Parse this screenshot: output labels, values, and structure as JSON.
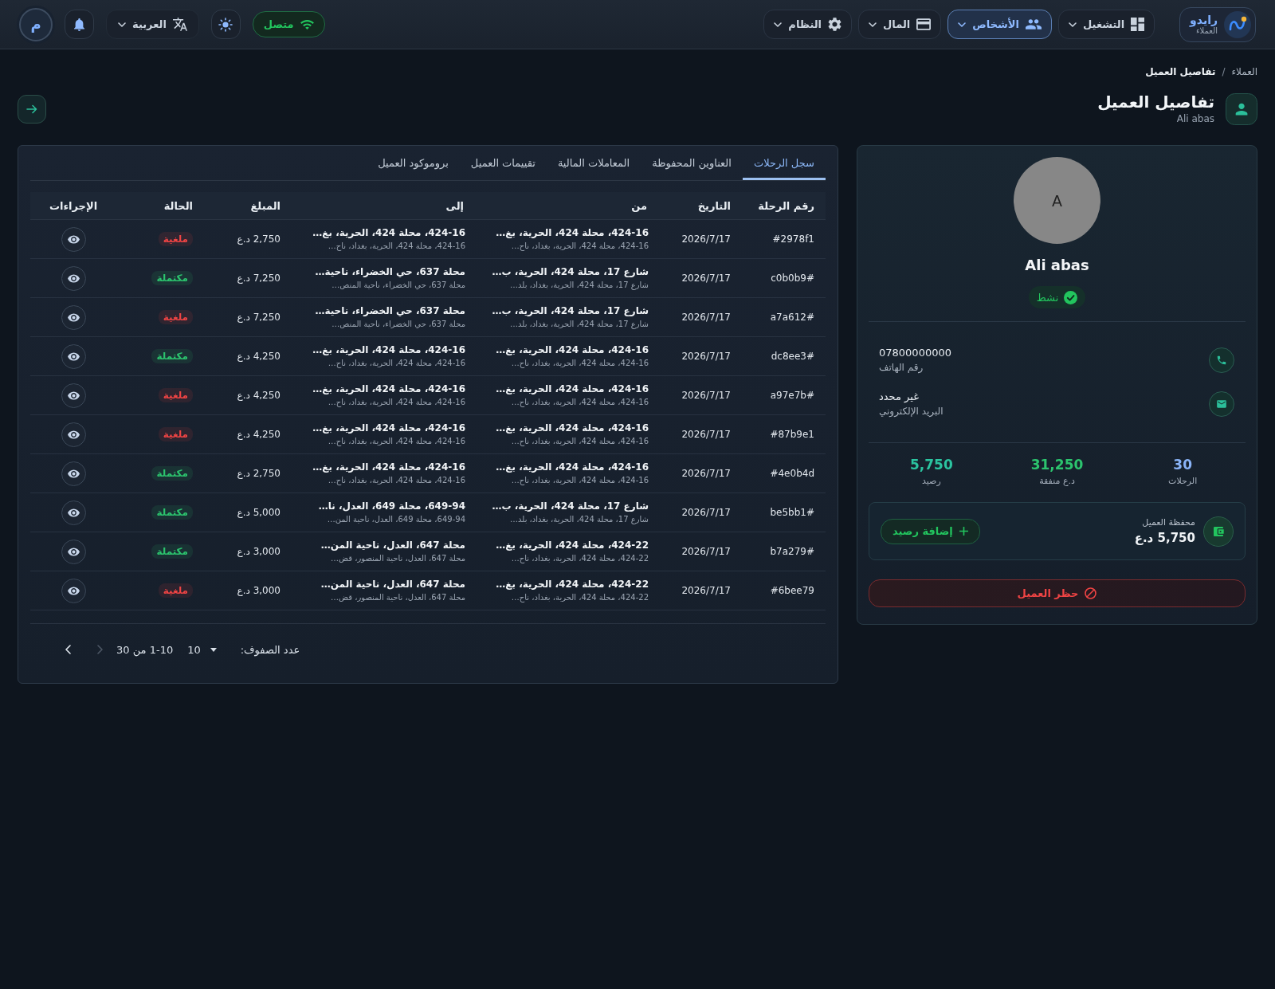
{
  "header": {
    "brand": {
      "name": "رايدو",
      "subtitle": "العملاء"
    },
    "nav": [
      {
        "label": "التشغيل",
        "selected": false
      },
      {
        "label": "الأشخاص",
        "selected": true
      },
      {
        "label": "المال",
        "selected": false
      },
      {
        "label": "النظام",
        "selected": false
      }
    ],
    "connection": {
      "label": "متصل",
      "connected": true
    },
    "language": {
      "label": "العربية"
    },
    "user": {
      "initial": "م"
    }
  },
  "breadcrumb": {
    "items": [
      "العملاء",
      "تفاصيل العميل"
    ],
    "separator": "/"
  },
  "page": {
    "title": "تفاصيل العميل",
    "subtitle": "Ali abas"
  },
  "customer": {
    "initial": "A",
    "name": "Ali abas",
    "status": {
      "label": "نشط",
      "active": true
    },
    "contacts": [
      {
        "kind": "phone",
        "value": "07800000000",
        "label": "رقم الهاتف"
      },
      {
        "kind": "email",
        "value": "غير محدد",
        "label": "البريد الإلكتروني"
      }
    ],
    "stats": [
      {
        "value": "30",
        "label": "الرحلات",
        "color": "#8ab4f8"
      },
      {
        "value": "31,250",
        "label": "د.ع منفقة",
        "color": "#2cc46e"
      },
      {
        "value": "5,750",
        "label": "رصيد",
        "color": "#2bc4a0"
      }
    ],
    "wallet": {
      "title": "محفظة العميل",
      "balance": "5,750 د.ع",
      "action": "إضافة رصيد"
    },
    "block_action": "حظر العميل"
  },
  "tabs": [
    {
      "label": "سجل الرحلات",
      "selected": true
    },
    {
      "label": "العناوين المحفوظة",
      "selected": false
    },
    {
      "label": "المعاملات المالية",
      "selected": false
    },
    {
      "label": "تقييمات العميل",
      "selected": false
    },
    {
      "label": "بروموكود العميل",
      "selected": false
    }
  ],
  "table": {
    "columns": [
      "رقم الرحلة",
      "التاريخ",
      "من",
      "إلى",
      "المبلغ",
      "الحالة",
      "الإجراءات"
    ],
    "rows": [
      {
        "id": "#2978f1",
        "date": "2026/7/17",
        "from": {
          "line": "424-16، محلة 424، الحرية، بغ…",
          "detail": "424-16، محلة 424، الحرية، بغداد، ناح…"
        },
        "to": {
          "line": "424-16، محلة 424، الحرية، بغ…",
          "detail": "424-16، محلة 424، الحرية، بغداد، ناح…"
        },
        "amount": "2,750 د.ع",
        "status": {
          "label": "ملغية",
          "color": "#ef4444"
        }
      },
      {
        "id": "#c0b0b9",
        "date": "2026/7/17",
        "from": {
          "line": "شارع 17، محلة 424، الحرية، ب…",
          "detail": "شارع 17، محلة 424، الحرية، بغداد، بلد…"
        },
        "to": {
          "line": "محلة 637، حي الخضراء، ناحية…",
          "detail": "محلة 637، حي الخضراء، ناحية المنص…"
        },
        "amount": "7,250 د.ع",
        "status": {
          "label": "مكتملة",
          "color": "#2cc46e"
        }
      },
      {
        "id": "#a7a612",
        "date": "2026/7/17",
        "from": {
          "line": "شارع 17، محلة 424، الحرية، ب…",
          "detail": "شارع 17، محلة 424، الحرية، بغداد، بلد…"
        },
        "to": {
          "line": "محلة 637، حي الخضراء، ناحية…",
          "detail": "محلة 637، حي الخضراء، ناحية المنص…"
        },
        "amount": "7,250 د.ع",
        "status": {
          "label": "ملغية",
          "color": "#ef4444"
        }
      },
      {
        "id": "#dc8ee3",
        "date": "2026/7/17",
        "from": {
          "line": "424-16، محلة 424، الحرية، بغ…",
          "detail": "424-16، محلة 424، الحرية، بغداد، ناح…"
        },
        "to": {
          "line": "424-16، محلة 424، الحرية، بغ…",
          "detail": "424-16، محلة 424، الحرية، بغداد، ناح…"
        },
        "amount": "4,250 د.ع",
        "status": {
          "label": "مكتملة",
          "color": "#2cc46e"
        }
      },
      {
        "id": "#a97e7b",
        "date": "2026/7/17",
        "from": {
          "line": "424-16، محلة 424، الحرية، بغ…",
          "detail": "424-16، محلة 424، الحرية، بغداد، ناح…"
        },
        "to": {
          "line": "424-16، محلة 424، الحرية، بغ…",
          "detail": "424-16، محلة 424، الحرية، بغداد، ناح…"
        },
        "amount": "4,250 د.ع",
        "status": {
          "label": "ملغية",
          "color": "#ef4444"
        }
      },
      {
        "id": "#87b9e1",
        "date": "2026/7/17",
        "from": {
          "line": "424-16، محلة 424، الحرية، بغ…",
          "detail": "424-16، محلة 424، الحرية، بغداد، ناح…"
        },
        "to": {
          "line": "424-16، محلة 424، الحرية، بغ…",
          "detail": "424-16، محلة 424، الحرية، بغداد، ناح…"
        },
        "amount": "4,250 د.ع",
        "status": {
          "label": "ملغية",
          "color": "#ef4444"
        }
      },
      {
        "id": "#4e0b4d",
        "date": "2026/7/17",
        "from": {
          "line": "424-16، محلة 424، الحرية، بغ…",
          "detail": "424-16، محلة 424، الحرية، بغداد، ناح…"
        },
        "to": {
          "line": "424-16، محلة 424، الحرية، بغ…",
          "detail": "424-16، محلة 424، الحرية، بغداد، ناح…"
        },
        "amount": "2,750 د.ع",
        "status": {
          "label": "مكتملة",
          "color": "#2cc46e"
        }
      },
      {
        "id": "#be5bb1",
        "date": "2026/7/17",
        "from": {
          "line": "شارع 17، محلة 424، الحرية، ب…",
          "detail": "شارع 17، محلة 424، الحرية، بغداد، بلد…"
        },
        "to": {
          "line": "649-94، محلة 649، العدل، نا…",
          "detail": "649-94، محلة 649، العدل، ناحية المن…"
        },
        "amount": "5,000 د.ع",
        "status": {
          "label": "مكتملة",
          "color": "#2cc46e"
        }
      },
      {
        "id": "#b7a279",
        "date": "2026/7/17",
        "from": {
          "line": "424-22، محلة 424، الحرية، بغ…",
          "detail": "424-22، محلة 424، الحرية، بغداد، ناح…"
        },
        "to": {
          "line": "محلة 647، العدل، ناحية المن…",
          "detail": "محلة 647، العدل، ناحية المنصور، قض…"
        },
        "amount": "3,000 د.ع",
        "status": {
          "label": "مكتملة",
          "color": "#2cc46e"
        }
      },
      {
        "id": "#6bee79",
        "date": "2026/7/17",
        "from": {
          "line": "424-22، محلة 424، الحرية، بغ…",
          "detail": "424-22، محلة 424، الحرية، بغداد، ناح…"
        },
        "to": {
          "line": "محلة 647، العدل، ناحية المن…",
          "detail": "محلة 647، العدل، ناحية المنصور، قض…"
        },
        "amount": "3,000 د.ع",
        "status": {
          "label": "ملغية",
          "color": "#ef4444"
        }
      }
    ]
  },
  "pagination": {
    "rows_label": "عدد الصفوف:",
    "rows_per_page": "10",
    "range": "1-10 من 30",
    "previous": {
      "disabled": true
    },
    "next": {
      "disabled": false
    }
  }
}
